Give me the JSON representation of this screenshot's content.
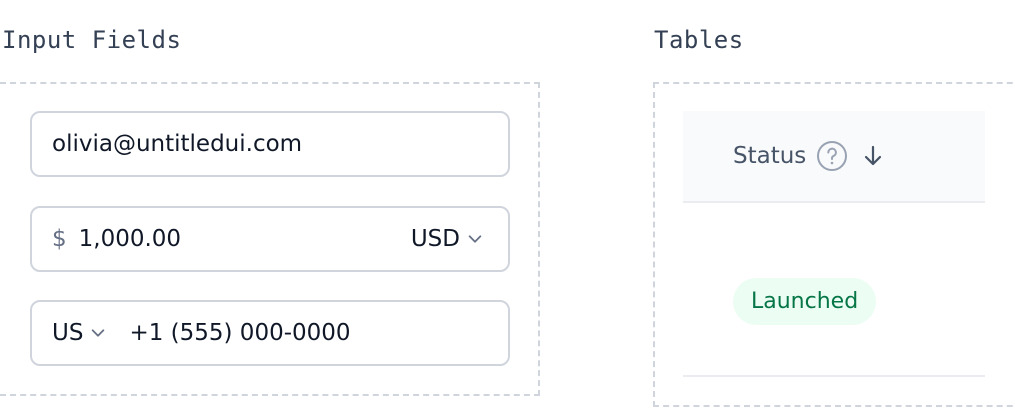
{
  "sections": {
    "inputs_title": "Input Fields",
    "tables_title": "Tables"
  },
  "inputs": {
    "email": {
      "value": "olivia@untitledui.com"
    },
    "amount": {
      "currency_symbol": "$",
      "value": "1,000.00",
      "currency": "USD"
    },
    "phone": {
      "country": "US",
      "value": "+1 (555) 000-0000"
    }
  },
  "table": {
    "header": {
      "status_label": "Status",
      "help_icon": "help-circle-icon",
      "sort_icon": "arrow-down-icon"
    },
    "rows": [
      {
        "status": "Launched",
        "status_color": "#067647",
        "status_bg": "#ecfdf3"
      }
    ]
  },
  "colors": {
    "border": "#d0d5dd",
    "text": "#101828",
    "muted": "#667085",
    "header_bg": "#f9fafb"
  }
}
